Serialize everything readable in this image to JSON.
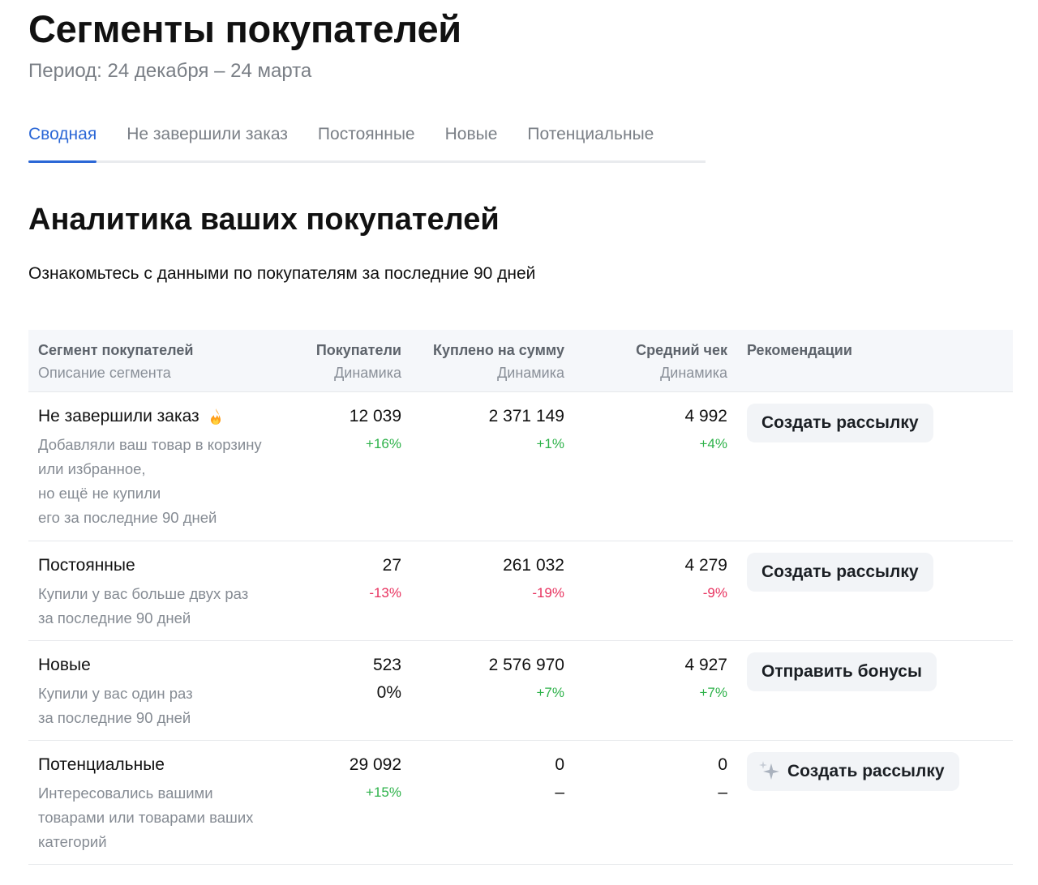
{
  "header": {
    "title": "Сегменты покупателей",
    "period": "Период: 24 декабря – 24 марта"
  },
  "tabs": [
    {
      "label": "Сводная",
      "active": true
    },
    {
      "label": "Не завершили заказ",
      "active": false
    },
    {
      "label": "Постоянные",
      "active": false
    },
    {
      "label": "Новые",
      "active": false
    },
    {
      "label": "Потенциальные",
      "active": false
    }
  ],
  "section": {
    "title": "Аналитика ваших покупателей",
    "subtitle": "Ознакомьтесь с данными по покупателям за последние 90 дней"
  },
  "table": {
    "headers": {
      "segment": "Сегмент покупателей",
      "segment_sub": "Описание сегмента",
      "buyers": "Покупатели",
      "buyers_sub": "Динамика",
      "amount": "Куплено на сумму",
      "amount_sub": "Динамика",
      "avg": "Средний чек",
      "avg_sub": "Динамика",
      "recs": "Рекомендации"
    },
    "rows": [
      {
        "name": "Не завершили заказ",
        "hot_icon": "fire-icon",
        "description": "Добавляли ваш товар в корзину\nили избранное,\nно ещё не купили\nего за последние 90 дней",
        "buyers": "12 039",
        "buyers_dyn": "+16%",
        "amount": "2 371 149",
        "amount_dyn": "+1%",
        "avg": "4 992",
        "avg_dyn": "+4%",
        "action": "Создать рассылку"
      },
      {
        "name": "Постоянные",
        "description": "Купили у вас больше двух раз\nза последние 90 дней",
        "buyers": "27",
        "buyers_dyn": "-13%",
        "amount": "261 032",
        "amount_dyn": "-19%",
        "avg": "4 279",
        "avg_dyn": "-9%",
        "action": "Создать рассылку"
      },
      {
        "name": "Новые",
        "description": "Купили у вас один раз\nза последние 90 дней",
        "buyers": "523",
        "buyers_dyn": "0%",
        "amount": "2 576 970",
        "amount_dyn": "+7%",
        "avg": "4 927",
        "avg_dyn": "+7%",
        "action": "Отправить бонусы"
      },
      {
        "name": "Потенциальные",
        "description": "Интересовались вашими\nтоварами или товарами ваших\nкатегорий",
        "buyers": "29 092",
        "buyers_dyn": "+15%",
        "amount": "0",
        "amount_dyn": "–",
        "avg": "0",
        "avg_dyn": "–",
        "action": "Создать рассылку",
        "action_icon": "sparkle-icon"
      }
    ]
  },
  "colors": {
    "accent": "#2b67d6",
    "positive": "#2eb24a",
    "negative": "#e8325f",
    "muted": "#7a7f86"
  }
}
